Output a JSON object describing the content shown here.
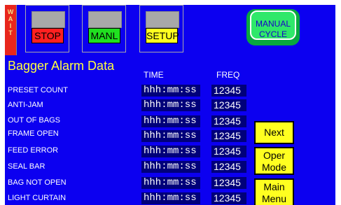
{
  "status_strip": {
    "letters": [
      "W",
      "A",
      "I",
      "T"
    ]
  },
  "nav": {
    "stop_label": "STOP",
    "manl_label": "MANL",
    "setup_label": "SETUP"
  },
  "cycle_button": {
    "line1": "MANUAL",
    "line2": "CYCLE"
  },
  "title": "Bagger Alarm Data",
  "columns": {
    "time": "TIME",
    "freq": "FREQ"
  },
  "alarms": [
    {
      "label": "PRESET COUNT",
      "time": "hhh:mm:ss",
      "freq": "12345"
    },
    {
      "label": "ANTI-JAM",
      "time": "hhh:mm:ss",
      "freq": "12345"
    },
    {
      "label": "OUT OF BAGS",
      "time": "hhh:mm:ss",
      "freq": "12345"
    },
    {
      "label": "FRAME OPEN",
      "time": "hhh:mm:ss",
      "freq": "12345"
    },
    {
      "label": "FEED ERROR",
      "time": "hhh:mm:ss",
      "freq": "12345"
    },
    {
      "label": "SEAL BAR",
      "time": "hhh:mm:ss",
      "freq": "12345"
    },
    {
      "label": "BAG NOT OPEN",
      "time": "hhh:mm:ss",
      "freq": "12345"
    },
    {
      "label": "LIGHT CURTAIN",
      "time": "hhh:mm:ss",
      "freq": "12345"
    }
  ],
  "side_buttons": {
    "next": "Next",
    "oper_mode_line1": "Oper",
    "oper_mode_line2": "Mode",
    "main_menu_line1": "Main",
    "main_menu_line2": "Menu"
  },
  "colors": {
    "background": "#0c00f0",
    "stop": "#ff2020",
    "manl": "#20e020",
    "setup": "#ffff20",
    "title": "#ffff40"
  }
}
